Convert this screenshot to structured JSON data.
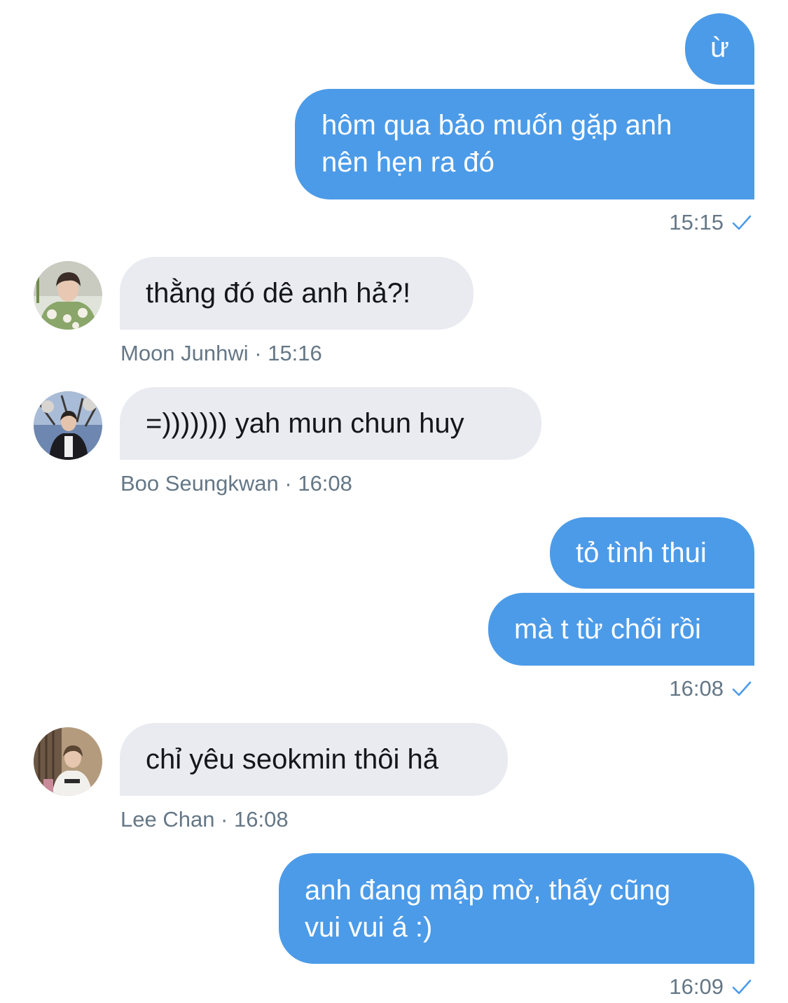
{
  "messages": {
    "m1": "ừ",
    "m2_line1": "hôm qua bảo muốn gặp anh",
    "m2_line2": "nên hẹn ra đó",
    "m2_time": "15:15",
    "m3": "thằng đó dê anh hả?!",
    "m3_meta": "Moon Junhwi · 15:16",
    "m4": "=))))))) yah mun chun huy",
    "m4_meta": "Boo Seungkwan · 16:08",
    "m5": "tỏ tình thui",
    "m6": "mà t từ chối rồi",
    "m6_time": "16:08",
    "m7": "chỉ yêu seokmin thôi hả",
    "m7_meta": "Lee Chan · 16:08",
    "m8_line1": "anh đang mập mờ, thấy cũng",
    "m8_line2": "vui vui á :)",
    "m8_time": "16:09"
  },
  "colors": {
    "outgoing_bubble": "#4c9be8",
    "incoming_bubble": "#e9ebf1",
    "meta_text": "#657786",
    "read_check": "#4c9be8"
  },
  "icons": {
    "read_receipt": "check-icon",
    "avatar_junhwi": "avatar-moon-junhwi",
    "avatar_seungkwan": "avatar-boo-seungkwan",
    "avatar_chan": "avatar-lee-chan"
  }
}
